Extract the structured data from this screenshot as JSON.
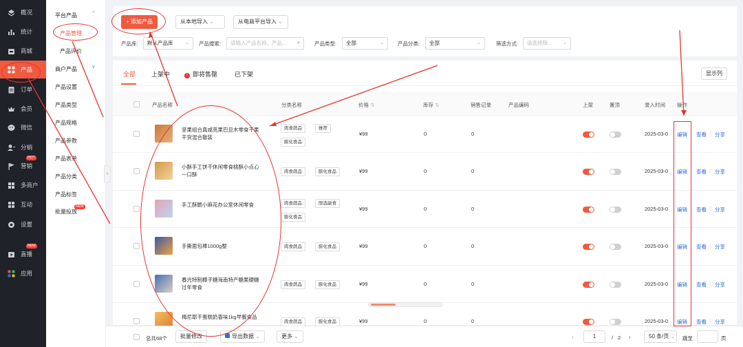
{
  "nav": [
    {
      "label": "概况",
      "icon": "dashboard-icon"
    },
    {
      "label": "统计",
      "icon": "chart-icon"
    },
    {
      "label": "商城",
      "icon": "shop-icon"
    },
    {
      "label": "产品",
      "icon": "grid-icon",
      "active": true
    },
    {
      "label": "订单",
      "icon": "order-icon"
    },
    {
      "label": "会员",
      "icon": "crown-icon"
    },
    {
      "label": "微信",
      "icon": "wechat-icon"
    },
    {
      "label": "分销",
      "icon": "user-share-icon"
    },
    {
      "label": "营销",
      "icon": "flag-icon",
      "badge": "HOT"
    },
    {
      "label": "多商户",
      "icon": "store-icon"
    },
    {
      "label": "互动",
      "icon": "interaction-icon"
    },
    {
      "label": "设置",
      "icon": "gear-icon"
    },
    {
      "label": "直播",
      "icon": "live-icon",
      "badge": "NEW"
    },
    {
      "label": "应用",
      "icon": "apps-icon"
    }
  ],
  "subnav": {
    "group1": "平台产品",
    "items1": [
      "产品管理",
      "产品评价"
    ],
    "group2": "商户产品",
    "items2": [
      "产品设置",
      "产品类型",
      "产品规格",
      "产品参数",
      "产品表单",
      "产品分类",
      "产品标签",
      "批量投放"
    ],
    "badge": "NEW"
  },
  "toolbar": {
    "add": "+ 添加产品",
    "import_local": "从本地导入",
    "import_ec": "从电商平台导入"
  },
  "filters": {
    "lib_label": "产品库:",
    "lib_value": "默认产品库",
    "search_label": "产品搜索:",
    "search_placeholder": "请输入产品名称、产品...",
    "type_label": "产品类型:",
    "type_value": "全部",
    "cat_label": "产品分类:",
    "cat_value": "全部",
    "filter_label": "筛选方式:",
    "filter_placeholder": "请选择筛..."
  },
  "tabs": [
    "全部",
    "上架中",
    "即将售罄",
    "已下架"
  ],
  "display_cols": "显示列",
  "columns": {
    "name": "产品名称",
    "category": "分类名称",
    "price": "价格",
    "stock": "库存",
    "sales": "销售记录",
    "code": "产品编码",
    "shelf": "上架",
    "top": "置顶",
    "date": "录入时间",
    "ops": "操作"
  },
  "rows": [
    {
      "name": "坚果组合真咸亮果巴旦木零食干果干货混合散装",
      "tags": [
        "肉食蔬品",
        "推荐",
        "膨化食品"
      ],
      "price": "¥99",
      "stock": "0",
      "sales": "0",
      "date": "2025-03-0",
      "shelf": true,
      "top": false
    },
    {
      "name": "小酥手工饼干休闲零食桃酥小点心一口酥",
      "tags": [
        "肉食蔬品",
        "膨化食品"
      ],
      "price": "¥99",
      "stock": "0",
      "sales": "0",
      "date": "2025-03-0",
      "shelf": true,
      "top": false
    },
    {
      "name": "手工酥脆小麻花办公室休闲零食",
      "tags": [
        "肉食蔬品",
        "限选副食",
        "膨化食品"
      ],
      "price": "¥99",
      "stock": "0",
      "sales": "0",
      "date": "2025-03-0",
      "shelf": true,
      "top": false
    },
    {
      "name": "手撕面包棒1000g整",
      "tags": [
        "肉食蔬品",
        "膨化食品"
      ],
      "price": "¥99",
      "stock": "0",
      "sales": "0",
      "date": "2025-03-0",
      "shelf": true,
      "top": false
    },
    {
      "name": "春光特制椰子糖海南特产糖果硬糖过年零食",
      "tags": [
        "肉食蔬品",
        "膨化食品"
      ],
      "price": "¥99",
      "stock": "0",
      "sales": "0",
      "date": "2025-03-0",
      "shelf": true,
      "top": false
    },
    {
      "name": "梅尼耶干蛋糕奶香味1kg早餐食品",
      "tags": [
        "肉食蔬品",
        "膨化食品"
      ],
      "price": "¥99",
      "stock": "0",
      "sales": "0",
      "date": "2025-03-0",
      "shelf": true,
      "top": false
    }
  ],
  "ops": {
    "edit": "编辑",
    "view": "查看",
    "share": "分享"
  },
  "footer": {
    "total": "总共68个",
    "batch_edit": "批量修改",
    "export": "导出数据",
    "more": "更多",
    "page": "1",
    "sep": "/",
    "pages": "2",
    "per_page": "50 条/页",
    "goto": "跳至",
    "page_unit": "页"
  },
  "colors": {
    "accent": "#f05a3f",
    "annotation": "#e8322f",
    "link": "#2d6fe0"
  }
}
